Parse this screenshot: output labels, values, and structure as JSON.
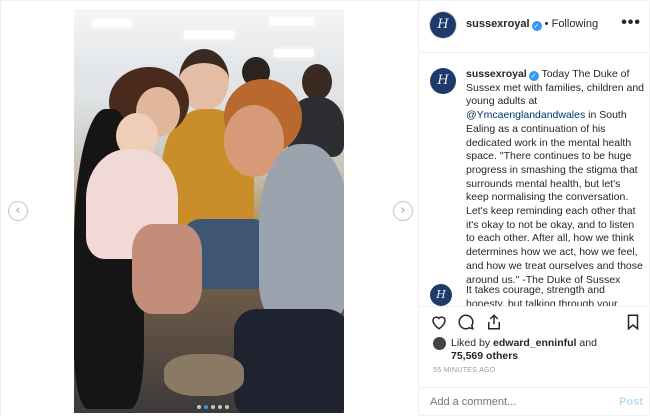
{
  "colors": {
    "accent": "#3897f0",
    "avatar_bg": "#1d3a6b",
    "link": "#003569",
    "post_disabled": "#b2dffc"
  },
  "header": {
    "avatar_glyph": "H",
    "username": "sussexroyal",
    "verified_glyph": "✓",
    "separator": "•",
    "follow_label": "Following",
    "more_glyph": "•••"
  },
  "caption": {
    "username": "sussexroyal",
    "part1": " Today The Duke of Sussex met with families, children and young adults at ",
    "mention": "@Ymcaenglandandwales",
    "part2": " in South Ealing as a continuation of his dedicated work in the mental health space. \"There continues to be huge progress in smashing the stigma that surrounds mental health, but let's keep normalising the conversation. Let's keep reminding each other that it's okay to not be okay, and to listen to each other. After all, how we think determines how we act, how we feel, and how we treat ourselves and those around us.\" -The Duke of Sussex"
  },
  "comment2": {
    "text": "It takes courage, strength and honesty, but talking through your"
  },
  "actions": {
    "icons": [
      "heart-icon",
      "comment-icon",
      "share-icon",
      "bookmark-icon"
    ]
  },
  "likes": {
    "liked_by_label": "Liked by",
    "liked_by_user": "edward_enninful",
    "and_label": "and",
    "others_count": "75,569 others"
  },
  "timestamp": "55 MINUTES AGO",
  "comment_input": {
    "placeholder": "Add a comment...",
    "post_label": "Post"
  },
  "carousel": {
    "prev_glyph": "‹",
    "next_glyph": "›",
    "dot_count": 5,
    "active_index": 1
  }
}
